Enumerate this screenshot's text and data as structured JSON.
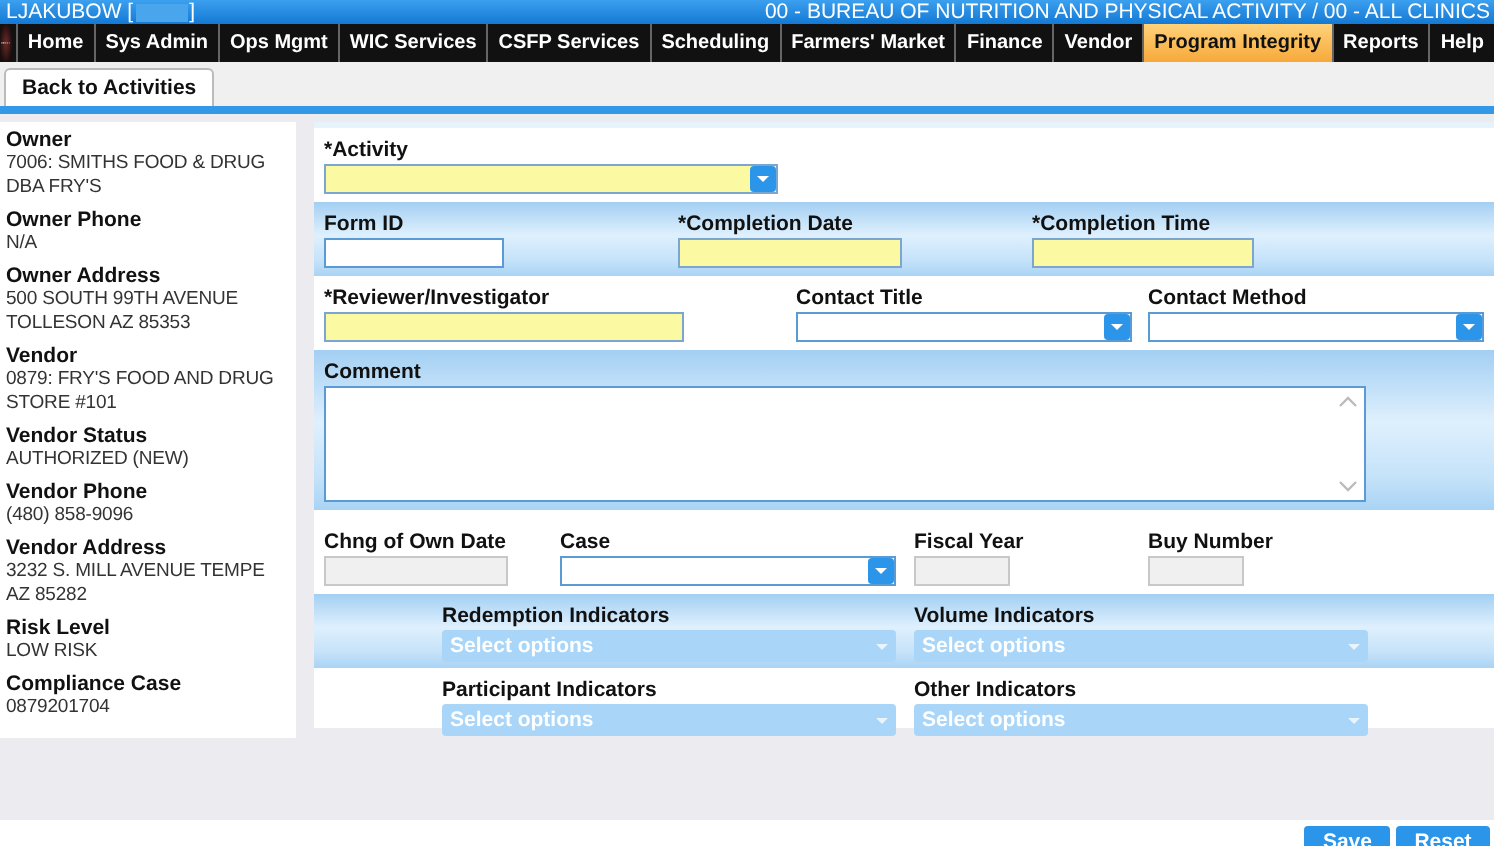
{
  "header": {
    "user_prefix": "LJAKUBOW [",
    "user_suffix": "]",
    "agency": "00 - BUREAU OF NUTRITION AND PHYSICAL ACTIVITY / 00 - ALL CLINICS"
  },
  "nav": [
    {
      "label": "Home",
      "selected": false
    },
    {
      "label": "Sys Admin",
      "selected": false
    },
    {
      "label": "Ops Mgmt",
      "selected": false
    },
    {
      "label": "WIC Services",
      "selected": false
    },
    {
      "label": "CSFP Services",
      "selected": false
    },
    {
      "label": "Scheduling",
      "selected": false
    },
    {
      "label": "Farmers' Market",
      "selected": false
    },
    {
      "label": "Finance",
      "selected": false
    },
    {
      "label": "Vendor",
      "selected": false
    },
    {
      "label": "Program Integrity",
      "selected": true
    },
    {
      "label": "Reports",
      "selected": false
    },
    {
      "label": "Help",
      "selected": false
    }
  ],
  "tabs": [
    {
      "label": "Back to Activities",
      "selected": true
    }
  ],
  "sidebar": [
    {
      "label": "Owner",
      "value": "7006: SMITHS FOOD & DRUG DBA FRY'S"
    },
    {
      "label": "Owner Phone",
      "value": "N/A"
    },
    {
      "label": "Owner Address",
      "value": "500 SOUTH 99TH AVENUE TOLLESON AZ 85353"
    },
    {
      "label": "Vendor",
      "value": "0879: FRY'S FOOD AND DRUG STORE #101"
    },
    {
      "label": "Vendor Status",
      "value": "AUTHORIZED (NEW)"
    },
    {
      "label": "Vendor Phone",
      "value": "(480) 858-9096"
    },
    {
      "label": "Vendor Address",
      "value": "3232 S. MILL AVENUE TEMPE AZ 85282"
    },
    {
      "label": "Risk Level",
      "value": "LOW RISK"
    },
    {
      "label": "Compliance Case",
      "value": "0879201704"
    }
  ],
  "form": {
    "rows": [
      {
        "shaded": false,
        "fields": [
          {
            "kind": "select",
            "label": "*Activity",
            "required": true,
            "disabled": false
          }
        ]
      },
      {
        "shaded": true,
        "fields": [
          {
            "kind": "text",
            "label": "Form ID",
            "required": false,
            "disabled": false
          },
          {
            "kind": "text",
            "label": "*Completion Date",
            "required": true,
            "disabled": false
          },
          {
            "kind": "text",
            "label": "*Completion Time",
            "required": true,
            "disabled": false
          }
        ]
      },
      {
        "shaded": false,
        "fields": [
          {
            "kind": "text",
            "label": "*Reviewer/Investigator",
            "required": true,
            "disabled": false
          },
          {
            "kind": "select",
            "label": "Contact Title",
            "required": false,
            "disabled": false
          },
          {
            "kind": "select",
            "label": "Contact Method",
            "required": false,
            "disabled": false
          }
        ]
      },
      {
        "shaded": true,
        "fields": [
          {
            "kind": "textarea",
            "label": "Comment",
            "required": false,
            "disabled": false
          }
        ]
      },
      {
        "shaded": false,
        "fields": [
          {
            "kind": "text",
            "label": "Chng of Own Date",
            "required": false,
            "disabled": true
          },
          {
            "kind": "select",
            "label": "Case",
            "required": false,
            "disabled": false
          },
          {
            "kind": "text",
            "label": "Fiscal Year",
            "required": false,
            "disabled": true
          },
          {
            "kind": "text",
            "label": "Buy Number",
            "required": false,
            "disabled": true
          }
        ]
      },
      {
        "shaded": true,
        "fields": [
          {
            "kind": "multiselect",
            "label": "Redemption Indicators",
            "placeholder": "Select options",
            "required": false,
            "disabled": false
          },
          {
            "kind": "multiselect",
            "label": "Volume Indicators",
            "placeholder": "Select options",
            "required": false,
            "disabled": false
          }
        ]
      },
      {
        "shaded": false,
        "fields": [
          {
            "kind": "multiselect",
            "label": "Participant Indicators",
            "placeholder": "Select options",
            "required": false,
            "disabled": false
          },
          {
            "kind": "multiselect",
            "label": "Other Indicators",
            "placeholder": "Select options",
            "required": false,
            "disabled": false
          }
        ]
      }
    ]
  },
  "actions": [
    {
      "label": "Save"
    },
    {
      "label": "Reset"
    }
  ]
}
